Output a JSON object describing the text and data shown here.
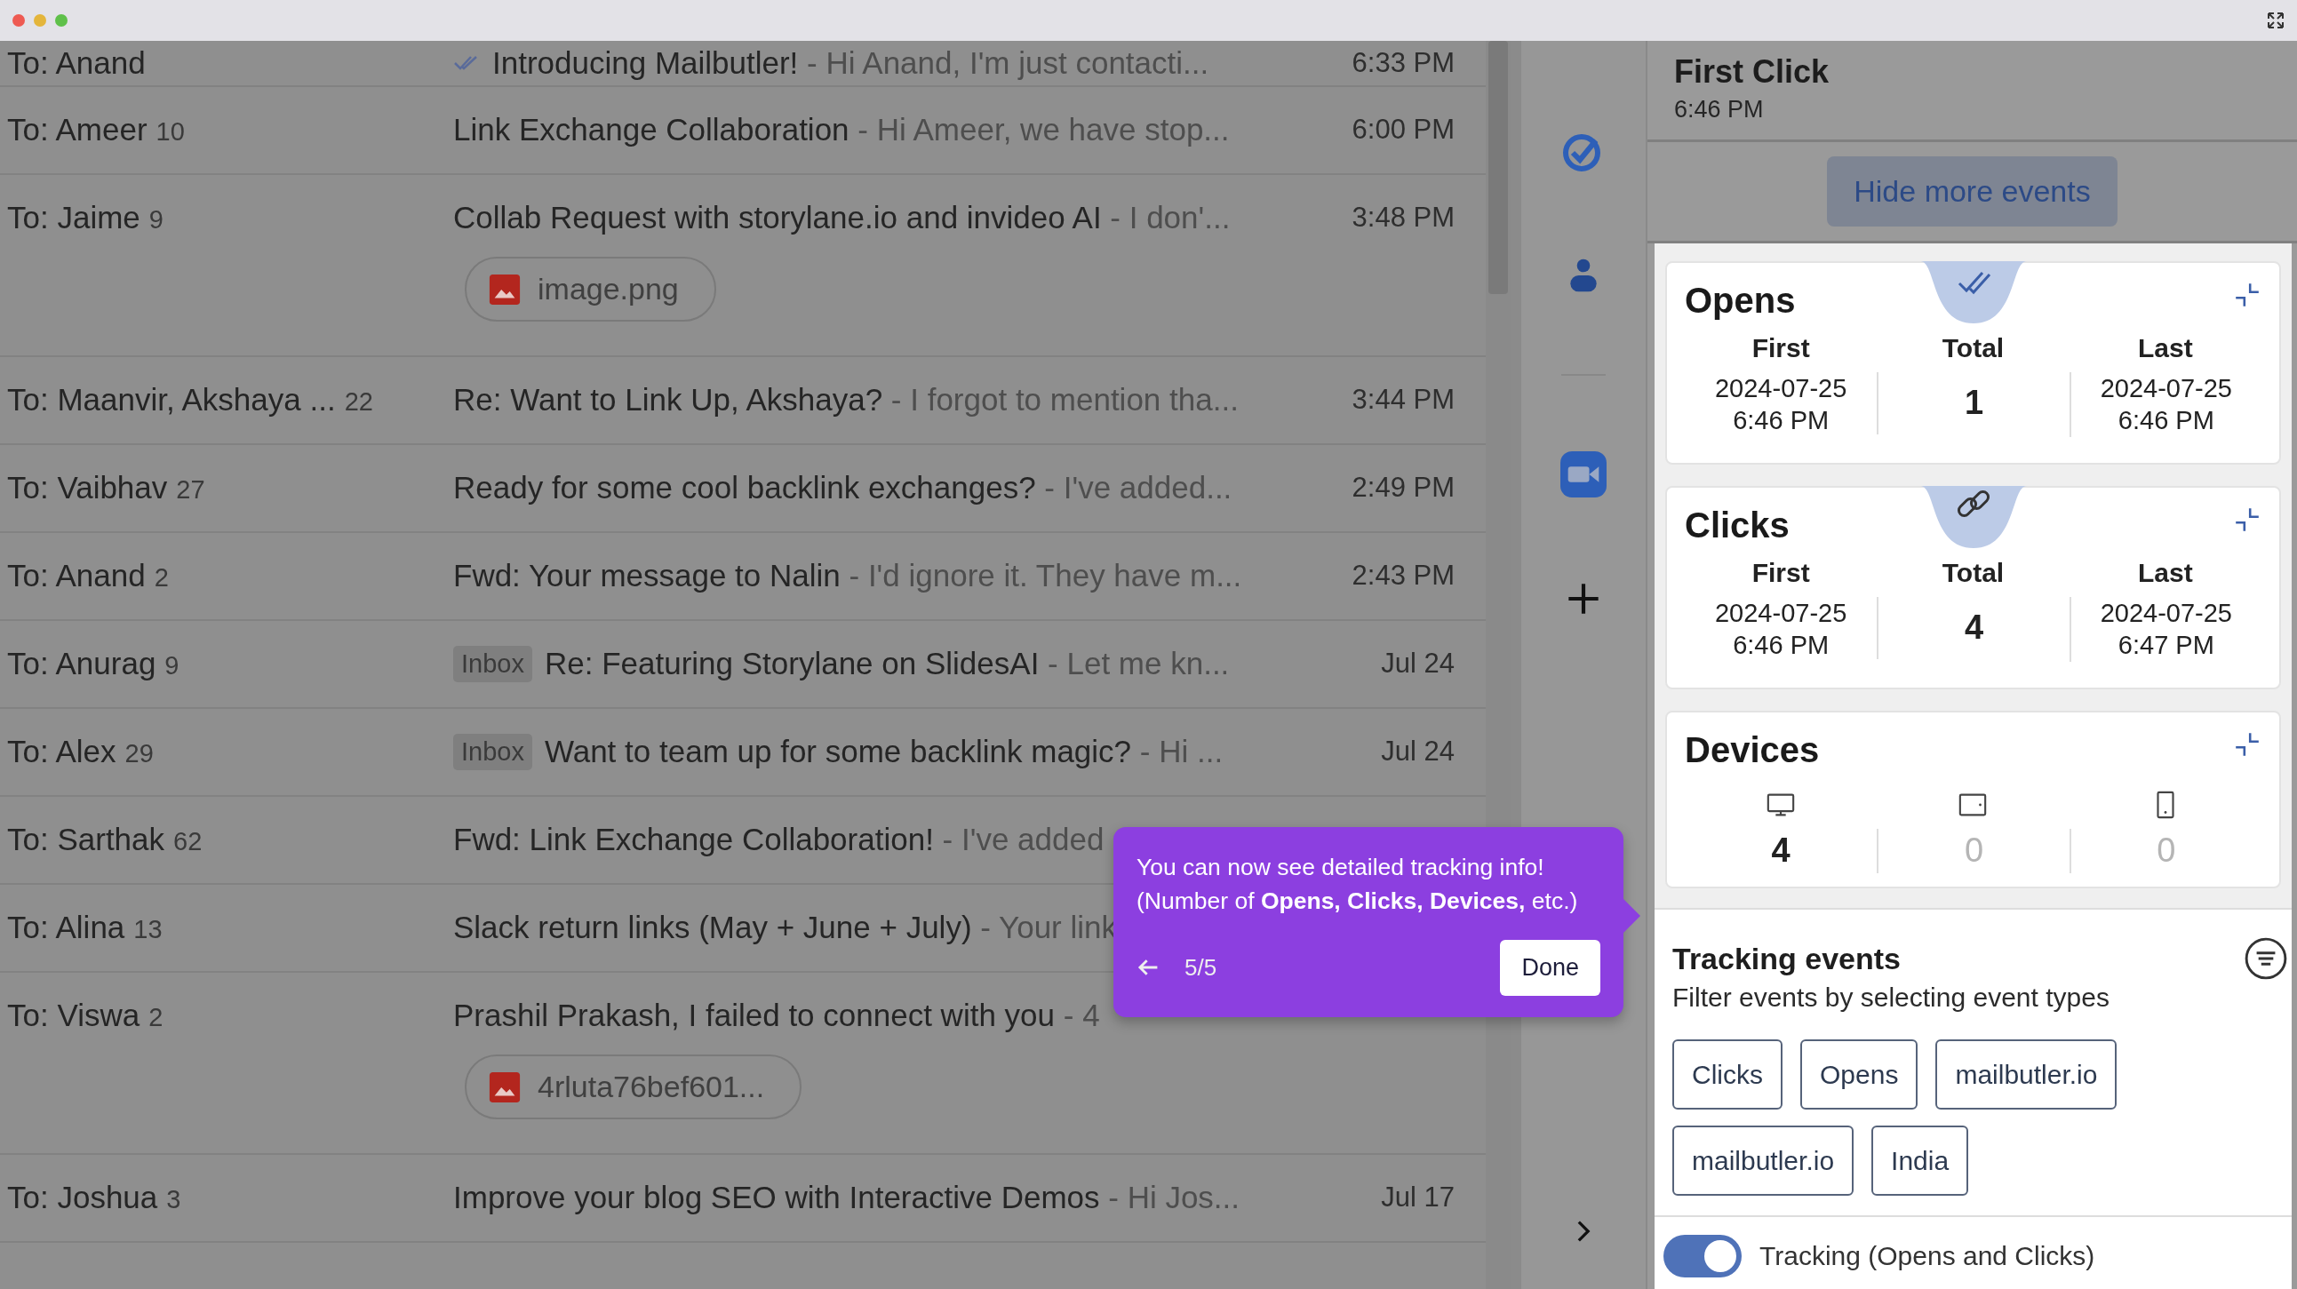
{
  "emails": [
    {
      "to": "To: Anand",
      "tracked": true,
      "subject": "Introducing Mailbutler!",
      "snippet": "- Hi Anand, I'm just contacti...",
      "time": "6:33 PM"
    },
    {
      "to": "To: Ameer",
      "count": "10",
      "tracked": false,
      "subject": "Link Exchange Collaboration",
      "snippet": "- Hi Ameer, we have stop...",
      "time": "6:00 PM"
    },
    {
      "to": "To: Jaime",
      "count": "9",
      "tracked": false,
      "subject": "Collab Request with storylane.io and invideo AI",
      "snippet": "- I don'...",
      "time": "3:48 PM",
      "attachment": "image.png"
    },
    {
      "to": "To: Maanvir, Akshaya ...",
      "count": "22",
      "tracked": false,
      "subject": "Re: Want to Link Up, Akshaya?",
      "snippet": "- I forgot to mention tha...",
      "time": "3:44 PM"
    },
    {
      "to": "To: Vaibhav",
      "count": "27",
      "tracked": false,
      "subject": "Ready for some cool backlink exchanges?",
      "snippet": "- I've added...",
      "time": "2:49 PM"
    },
    {
      "to": "To: Anand",
      "count": "2",
      "tracked": false,
      "subject": "Fwd: Your message to Nalin",
      "snippet": "- I'd ignore it. They have m...",
      "time": "2:43 PM"
    },
    {
      "to": "To: Anurag",
      "count": "9",
      "tracked": false,
      "label": "Inbox",
      "subject": "Re: Featuring Storylane on SlidesAI",
      "snippet": "- Let me kn...",
      "time": "Jul 24"
    },
    {
      "to": "To: Alex",
      "count": "29",
      "tracked": false,
      "label": "Inbox",
      "subject": "Want to team up for some backlink magic?",
      "snippet": "- Hi ...",
      "time": "Jul 24"
    },
    {
      "to": "To: Sarthak",
      "count": "62",
      "tracked": false,
      "subject": "Fwd: Link Exchange Collaboration!",
      "snippet": "- I've added"
    },
    {
      "to": "To: Alina",
      "count": "13",
      "tracked": false,
      "subject": "Slack return links (May + June + July)",
      "snippet": "- Your link"
    },
    {
      "to": "To: Viswa",
      "count": "2",
      "tracked": false,
      "subject": "Prashil Prakash, I failed to connect with you",
      "snippet": "- 4",
      "attachment": "4rluta76bef601..."
    },
    {
      "to": "To: Joshua",
      "count": "3",
      "tracked": false,
      "subject": "Improve your blog SEO with Interactive Demos",
      "snippet": "- Hi Jos...",
      "time": "Jul 17"
    }
  ],
  "rail": [
    {
      "kind": "check"
    },
    {
      "kind": "person"
    },
    {
      "kind": "divider"
    },
    {
      "kind": "video"
    },
    {
      "kind": "plus"
    }
  ],
  "event": {
    "title": "First Click",
    "time": "6:46 PM",
    "button": "Hide more events"
  },
  "cards": [
    {
      "kind": "stats",
      "title": "Opens",
      "columns": [
        {
          "label": "First",
          "value": "2024-07-25\n6:46 PM"
        },
        {
          "label": "Total",
          "value": "1"
        },
        {
          "label": "Last",
          "value": "2024-07-25\n6:46 PM"
        }
      ]
    },
    {
      "kind": "stats",
      "title": "Clicks",
      "columns": [
        {
          "label": "First",
          "value": "2024-07-25\n6:46 PM"
        },
        {
          "label": "Total",
          "value": "4"
        },
        {
          "label": "Last",
          "value": "2024-07-25\n6:47 PM"
        }
      ]
    },
    {
      "kind": "devices",
      "title": "Devices",
      "devices": [
        {
          "kind": "desktop",
          "value": "4",
          "dimmed": false
        },
        {
          "kind": "tablet",
          "value": "0",
          "dimmed": true
        },
        {
          "kind": "phone",
          "value": "0",
          "dimmed": true
        }
      ]
    }
  ],
  "tracking": {
    "title": "Tracking events",
    "subtitle": "Filter events by selecting event types",
    "filters": [
      "Clicks",
      "Opens",
      "mailbutler.io",
      "mailbutler.io",
      "India"
    ],
    "toggle": {
      "label": "Tracking (Opens and Clicks)",
      "on": true
    }
  },
  "tour": {
    "text": "You can now see detailed tracking info!\n(Number of **Opens, Clicks, Devices,** etc.)",
    "step": "5/5",
    "button": "Done"
  }
}
